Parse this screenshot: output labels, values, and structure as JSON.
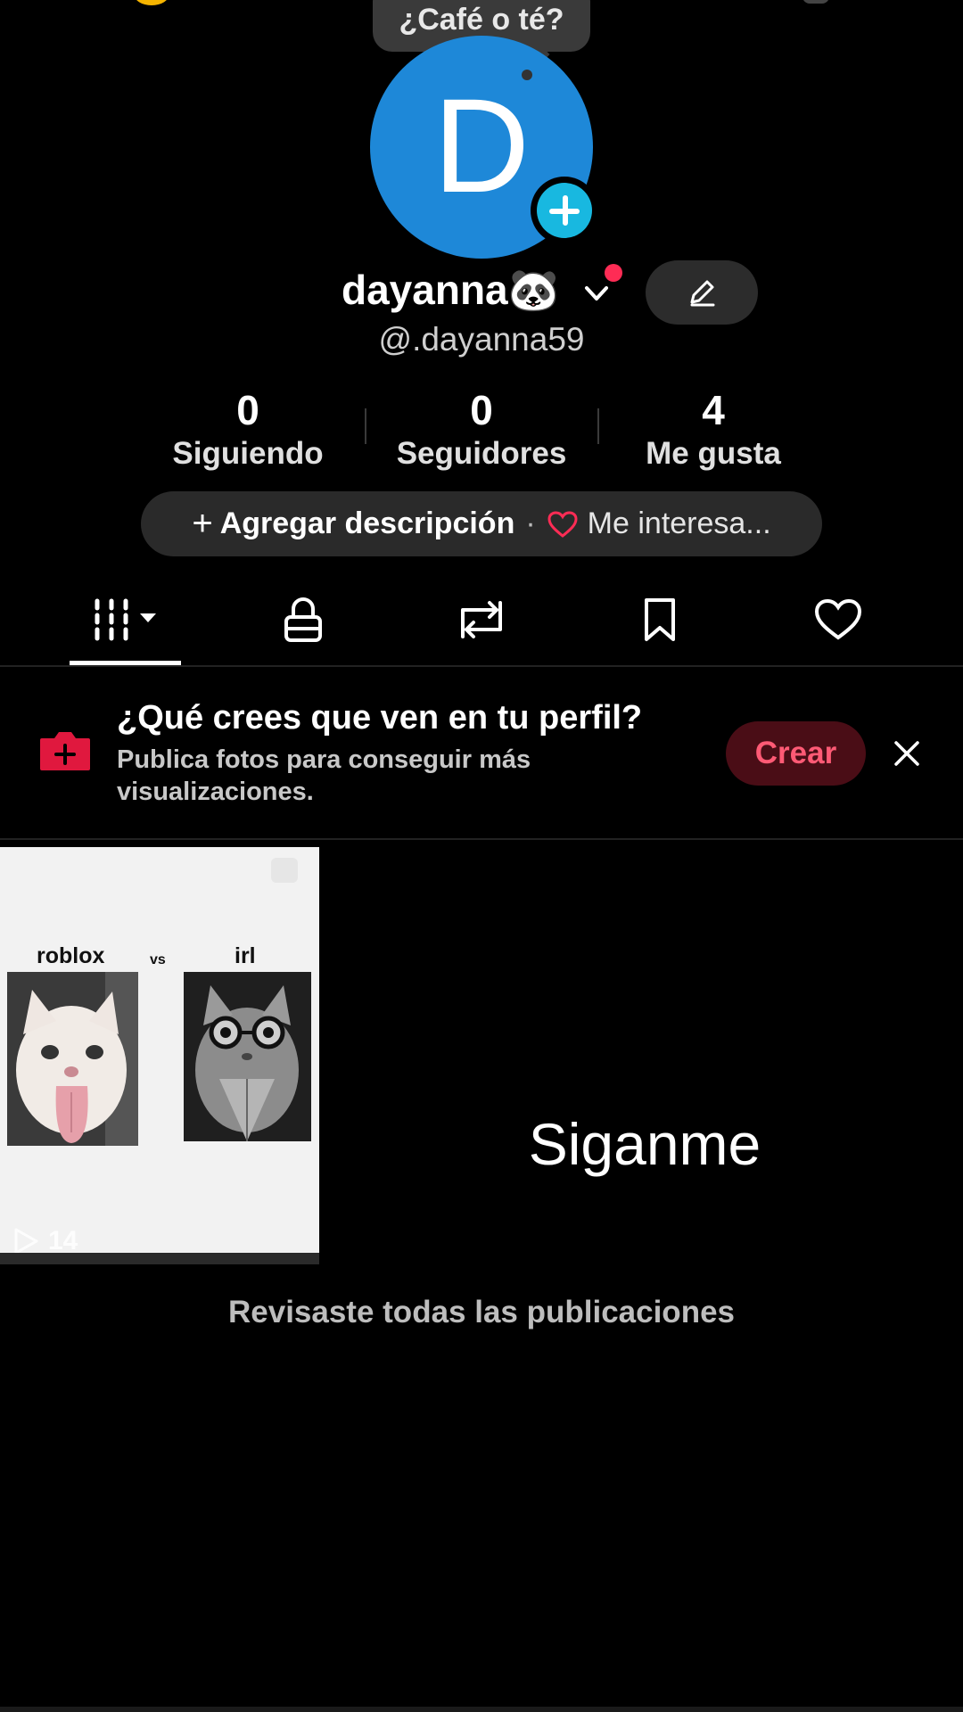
{
  "tooltip": {
    "text": "¿Café o té?"
  },
  "avatar": {
    "letter": "D",
    "color": "#1e88d8"
  },
  "profile": {
    "display_name": "dayanna🐼",
    "handle": "@.dayanna59"
  },
  "stats": [
    {
      "value": "0",
      "label": "Siguiendo"
    },
    {
      "value": "0",
      "label": "Seguidores"
    },
    {
      "value": "4",
      "label": "Me gusta"
    }
  ],
  "description_pill": {
    "plus": "+",
    "add_description": "Agregar descripción",
    "separator": "·",
    "interests": "Me interesa..."
  },
  "tabs": [
    {
      "icon": "grid-icon",
      "active": true
    },
    {
      "icon": "lock-icon",
      "active": false
    },
    {
      "icon": "repost-icon",
      "active": false
    },
    {
      "icon": "bookmark-icon",
      "active": false
    },
    {
      "icon": "heart-icon",
      "active": false
    }
  ],
  "banner": {
    "title": "¿Qué crees que ven en tu perfil?",
    "subtitle": "Publica fotos para conseguir más visualizaciones.",
    "button": "Crear"
  },
  "video": {
    "left_label": "roblox",
    "vs_label": "vs",
    "right_label": "irl",
    "views": "14"
  },
  "post_caption": "Siganme",
  "end_message": "Revisaste todas las publicaciones",
  "colors": {
    "accent": "#fe2c55",
    "crear_text": "#ff5a75",
    "crear_bg": "#4a0d16",
    "add_badge": "#18b8e0"
  }
}
